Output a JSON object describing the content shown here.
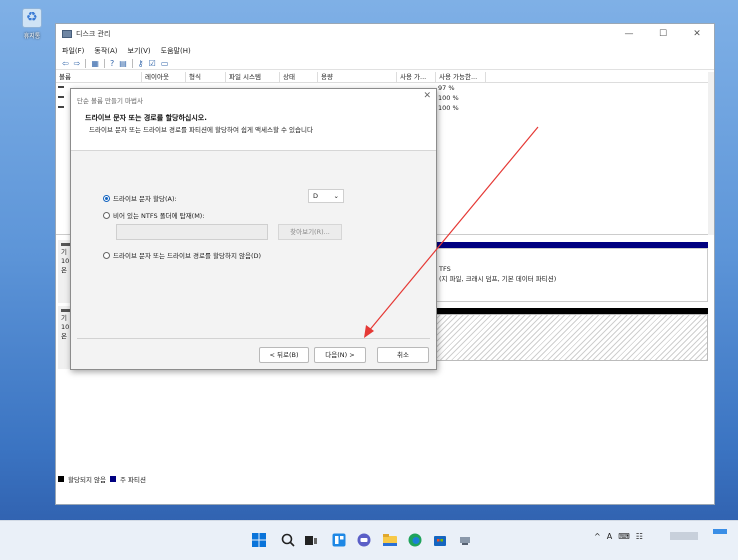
{
  "desktop": {
    "recycle_label": "휴지통"
  },
  "window": {
    "title": "디스크 관리",
    "controls": [
      "—",
      "☐",
      "✕"
    ],
    "menu": [
      "파일(F)",
      "동작(A)",
      "보기(V)",
      "도움말(H)"
    ],
    "table_headers": [
      "볼륨",
      "레이아웃",
      "형식",
      "파일 시스템",
      "상태",
      "용량",
      "사용 가...",
      "사용 가능한..."
    ],
    "row_pcts": [
      "97 %",
      "100 %",
      "100 %"
    ],
    "disk0_part_text": [
      "TFS",
      "(지 파일, 크래시 덤프, 기본 데이터 파티션)"
    ],
    "disk_labels": [
      [
        "기",
        "10",
        "온"
      ],
      [
        "기",
        "10",
        "온"
      ]
    ],
    "legend": [
      "할당되지 않음",
      "주 파티션"
    ]
  },
  "dialog": {
    "title": "단순 볼륨 만들기 마법사",
    "heading": "드라이브 문자 또는 경로를 할당하십시오.",
    "subheading": "드라이브 문자 또는 드라이브 경로를 파티션에 할당하여 쉽게 액세스할 수 있습니다",
    "opt_assign": "드라이브 문자 할당(A):",
    "opt_mount": "비어 있는 NTFS 폴더에 탑재(M):",
    "opt_none": "드라이브 문자 또는 드라이브 경로를 할당하지 않음(D)",
    "drive_letter": "D",
    "browse": "찾아보기(R)...",
    "back": "< 뒤로(B)",
    "next": "다음(N) >",
    "cancel": "취소"
  },
  "taskbar": {
    "tray": [
      "^",
      "A"
    ]
  },
  "colors": {
    "accent": "#1565c0",
    "primary_partition": "#000080",
    "annotation_arrow": "#e53935"
  }
}
